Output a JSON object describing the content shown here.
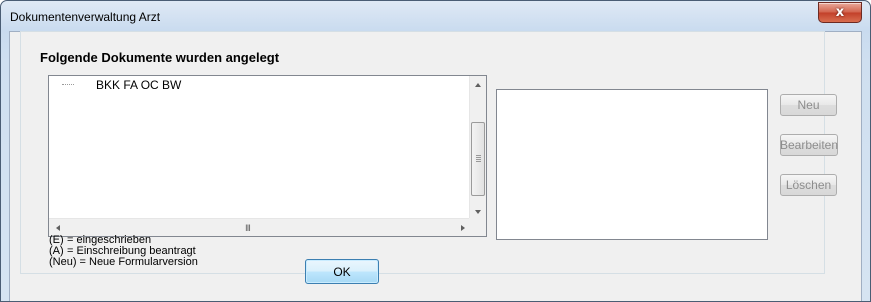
{
  "window": {
    "title": "Dokumentenverwaltung Arzt",
    "close_glyph": "x"
  },
  "group": {
    "title": "Folgende Dokumente wurden angelegt"
  },
  "document_list": {
    "items": [
      {
        "label": "BKK FA OC BW"
      }
    ],
    "hscroll_grip": "III"
  },
  "buttons": {
    "new": "Neu",
    "edit": "Bearbeiten",
    "delete": "Löschen",
    "ok": "OK"
  },
  "legend": [
    {
      "key": "(E)",
      "text": "= eingeschrieben"
    },
    {
      "key": "(A)",
      "text": "= Einschreibung beantragt"
    },
    {
      "key": "(Neu)",
      "text": "= Neue Formularversion"
    }
  ],
  "colors": {
    "title_gradient_top": "#dfe9f5",
    "dialog_bg": "#f0f0f0",
    "close_button": "#c2402a",
    "disabled_text": "#8d8d8d",
    "ok_button": "#bee6fd"
  }
}
